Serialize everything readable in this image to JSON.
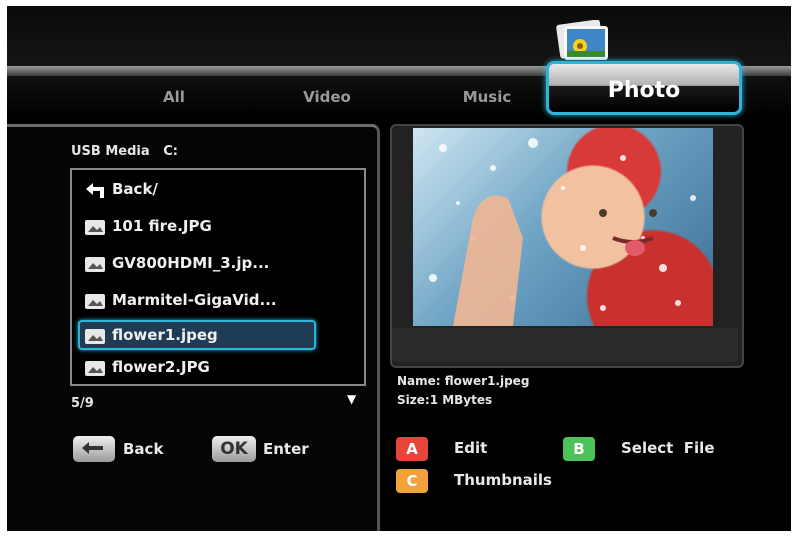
{
  "tabs": [
    {
      "label": "All"
    },
    {
      "label": "Video"
    },
    {
      "label": "Music"
    },
    {
      "label": "Photo"
    }
  ],
  "active_tab": "Photo",
  "browser": {
    "device_label": "USB Media",
    "drive_label": "C:",
    "items": [
      {
        "label": "Back/",
        "icon": "back-arrow-icon"
      },
      {
        "label": "101 fire.JPG",
        "icon": "image-file-icon"
      },
      {
        "label": "GV800HDMI_3.jp...",
        "icon": "image-file-icon"
      },
      {
        "label": "Marmitel-GigaVid...",
        "icon": "image-file-icon"
      },
      {
        "label": "flower1.jpeg",
        "icon": "image-file-icon"
      },
      {
        "label": "flower2.JPG",
        "icon": "image-file-icon"
      }
    ],
    "selected_index": 4,
    "position": "5/9"
  },
  "hints": {
    "back_label": "Back",
    "ok_key": "OK",
    "enter_label": "Enter"
  },
  "preview": {
    "image_subject": "smiling baby in red swim cap"
  },
  "file_info": {
    "name_label": "Name:",
    "name_value": "flower1.jpeg",
    "size_label": "Size:",
    "size_value": "1  MBytes"
  },
  "color_keys": [
    {
      "key": "A",
      "label": "Edit",
      "color": "#e8453c"
    },
    {
      "key": "B",
      "label": "Select  File",
      "color": "#4cc25a"
    },
    {
      "key": "C",
      "label": "Thumbnails",
      "color": "#f2a23a"
    }
  ],
  "colors": {
    "accent": "#2fb4d8",
    "background": "#000000"
  }
}
